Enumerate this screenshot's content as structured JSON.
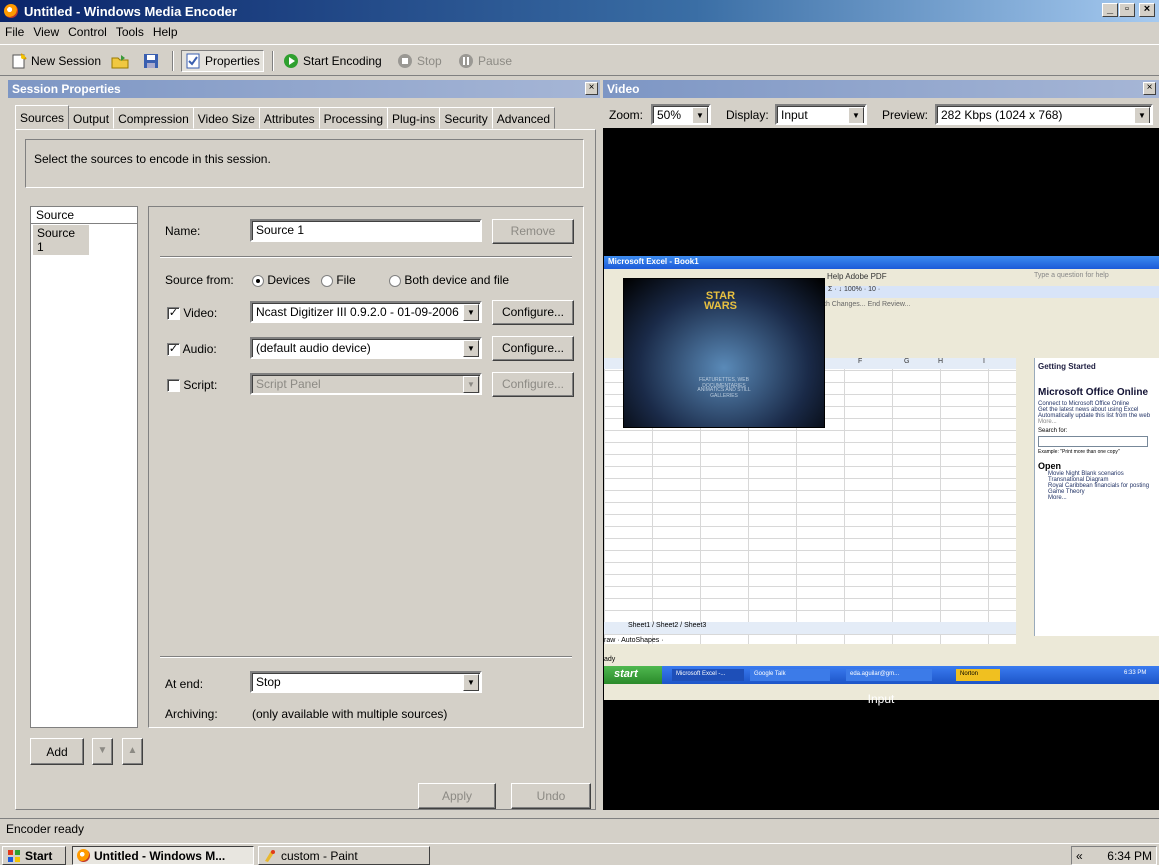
{
  "window": {
    "title": "Untitled - Windows Media Encoder",
    "min": "_",
    "max": "▫",
    "close": "×"
  },
  "menu": [
    "File",
    "View",
    "Control",
    "Tools",
    "Help"
  ],
  "toolbar": {
    "new_session": "New Session",
    "properties": "Properties",
    "start_encoding": "Start Encoding",
    "stop": "Stop",
    "pause": "Pause"
  },
  "session": {
    "header": "Session Properties",
    "close": "×",
    "tabs": [
      "Sources",
      "Output",
      "Compression",
      "Video Size",
      "Attributes",
      "Processing",
      "Plug-ins",
      "Security",
      "Advanced"
    ],
    "description": "Select the sources to encode in this session.",
    "source_list": {
      "header": "Source",
      "items": [
        "Source 1"
      ]
    },
    "name_label": "Name:",
    "name_value": "Source 1",
    "remove": "Remove",
    "source_from_label": "Source from:",
    "source_from_options": [
      "Devices",
      "File",
      "Both device and file"
    ],
    "video": {
      "label": "Video:",
      "checked": true,
      "value": "Ncast Digitizer III 0.9.2.0  -  01-09-2006",
      "configure": "Configure..."
    },
    "audio": {
      "label": "Audio:",
      "checked": true,
      "value": "(default audio device)",
      "configure": "Configure..."
    },
    "script": {
      "label": "Script:",
      "checked": false,
      "value": "Script Panel",
      "configure": "Configure..."
    },
    "at_end_label": "At end:",
    "at_end_value": "Stop",
    "archiving_label": "Archiving:",
    "archiving_value": "(only available with multiple sources)",
    "add": "Add",
    "move_down": "▼",
    "move_up": "▲",
    "apply": "Apply",
    "undo": "Undo"
  },
  "video": {
    "header": "Video",
    "close": "×",
    "zoom_label": "Zoom:",
    "zoom_value": "50%",
    "display_label": "Display:",
    "display_value": "Input",
    "preview_label": "Preview:",
    "preview_value": "282 Kbps (1024 x 768)",
    "inner": {
      "title": "Microsoft Excel - Book1",
      "menu": "Help  Adobe PDF",
      "question_box": "Type a question for help",
      "tools": "Σ · ↓ 100% · 10 ·",
      "review": "th Changes...  End Review...",
      "columns": [
        "F",
        "G",
        "H",
        "I"
      ],
      "rows": [
        "9",
        "10",
        "11",
        "12",
        "13",
        "14",
        "15",
        "16",
        "17",
        "18",
        "19",
        "20"
      ],
      "sheet_tabs": [
        "Sheet1",
        "Sheet2",
        "Sheet3"
      ],
      "draw_bar": "raw · AutoShapes ·",
      "ready": "ady",
      "pane": {
        "title": "Getting Started",
        "heading": "Microsoft Office Online",
        "links": [
          "Connect to Microsoft Office Online",
          "Get the latest news about using Excel",
          "Automatically update this list from the web"
        ],
        "more": "More...",
        "search_label": "Search for:",
        "example": "Example: \"Print more than one copy\"",
        "open_heading": "Open",
        "files": [
          "Movie Night Blank scenarios",
          "Transnational Diagram",
          "Royal Caribbean financials for posting",
          "Game Theory"
        ],
        "more2": "More..."
      },
      "taskbar": {
        "start": "start",
        "items": [
          "Microsoft Excel -...",
          "Google Talk",
          "eda.aguilar@gm...",
          "Norton"
        ],
        "clock": "6:33 PM"
      },
      "movie": {
        "line1": "STAR",
        "line2": "WARS",
        "caption1": "FEATURETTES, WEB DOCUMENTARIES",
        "caption2": "ANIMATICS AND STILL GALLERIES"
      }
    },
    "caption": "Input"
  },
  "status": "Encoder ready",
  "taskbar": {
    "start": "Start",
    "items": [
      "Untitled - Windows M...",
      "custom - Paint"
    ],
    "chevron": "«",
    "clock": "6:34 PM"
  },
  "colors": {
    "title_active": "#0a246a",
    "pane_header": "#7d96c4",
    "face": "#d4d0c8"
  }
}
